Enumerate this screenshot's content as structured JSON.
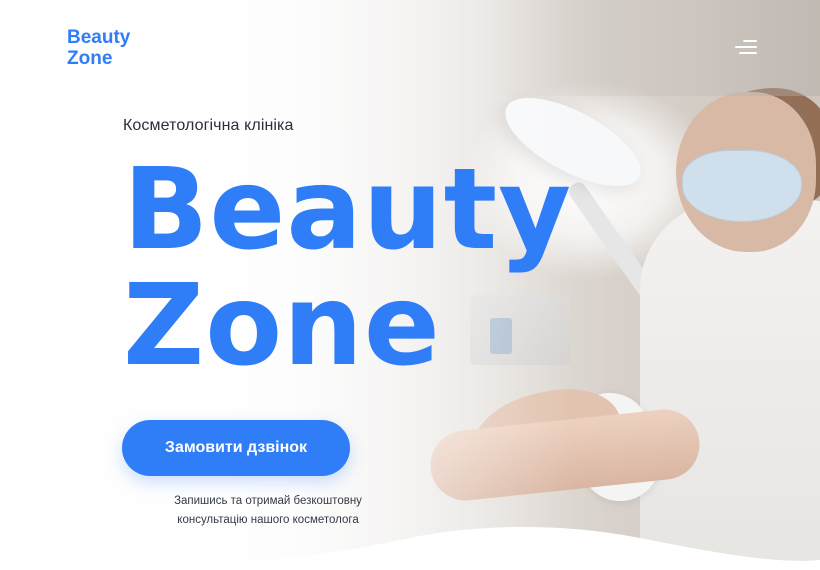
{
  "header": {
    "logo_line1": "Beauty",
    "logo_line2": "Zone",
    "menu_icon": "hamburger-menu-icon"
  },
  "hero": {
    "subtitle": "Косметологічна клініка",
    "title_line1": "Beauty",
    "title_line2": "Zone",
    "cta_label": "Замовити дзвінок",
    "cta_note_line1": "Запишись та отримай безкоштовну",
    "cta_note_line2": "консультацію нашого косметолога"
  },
  "colors": {
    "accent": "#2f7ef8",
    "text_dark": "#2a2f3a",
    "menu_icon": "#ffffff"
  }
}
